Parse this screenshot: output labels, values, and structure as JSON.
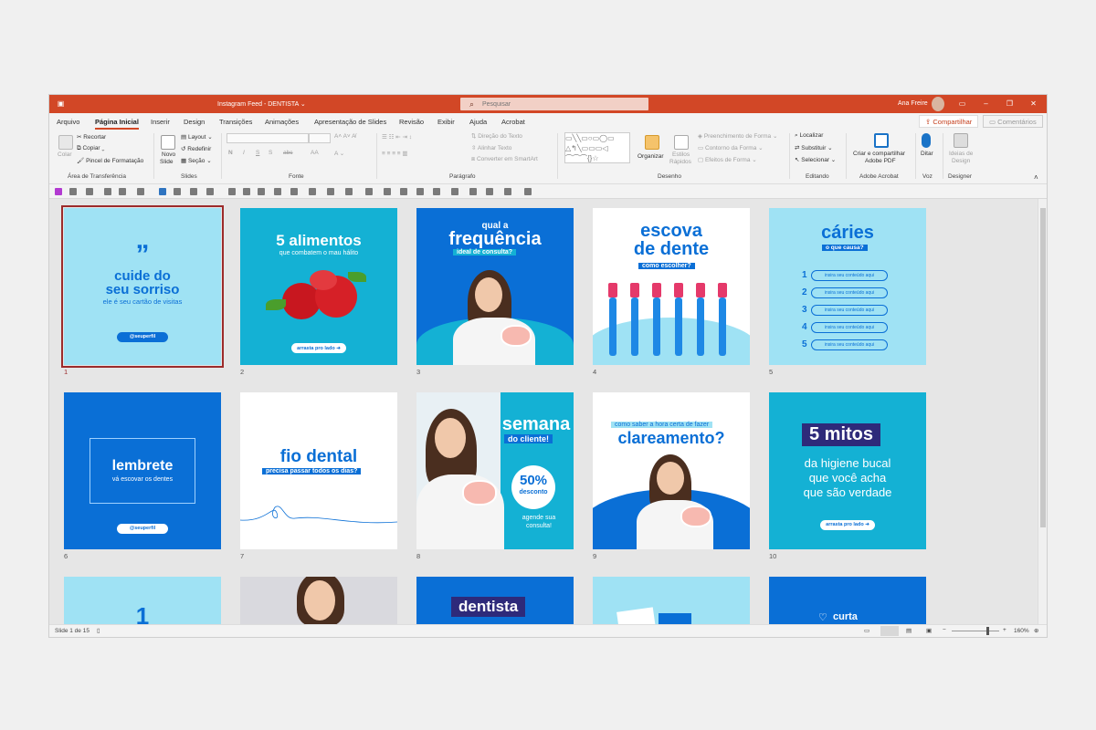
{
  "window": {
    "title": "Instagram Feed - DENTISTA",
    "title_caret": "⌄",
    "user": "Ana Freire"
  },
  "search": {
    "placeholder": "Pesquisar"
  },
  "tabs": [
    "Arquivo",
    "Página Inicial",
    "Inserir",
    "Design",
    "Transições",
    "Animações",
    "Apresentação de Slides",
    "Revisão",
    "Exibir",
    "Ajuda",
    "Acrobat"
  ],
  "share": {
    "label": "Compartilhar",
    "comments": "Comentários"
  },
  "ribbon": {
    "groups": [
      "Área de Transferência",
      "Slides",
      "Fonte",
      "Parágrafo",
      "Desenho",
      "Editando",
      "Adobe Acrobat",
      "Voz",
      "Designer"
    ],
    "clipboard": {
      "paste": "Colar",
      "cut": "Recortar",
      "copy": "Copiar",
      "format_painter": "Pincel de Formatação"
    },
    "slides": {
      "new_slide": "Novo",
      "new_slide2": "Slide",
      "layout": "Layout",
      "reset": "Redefinir",
      "section": "Seção"
    },
    "font": {
      "bold": "N",
      "italic": "I",
      "underline": "S",
      "strike": "S",
      "aa": "AA"
    },
    "paragraph": {
      "text_direction": "Direção do Texto",
      "align_text": "Alinhar Texto",
      "smartart": "Converter em SmartArt"
    },
    "drawing": {
      "arrange": "Organizar",
      "quick_styles": "Estilos",
      "quick_styles2": "Rápidos",
      "fill": "Preenchimento de Forma",
      "outline": "Contorno da Forma",
      "effects": "Efeitos de Forma"
    },
    "editing": {
      "find": "Localizar",
      "replace": "Substituir",
      "select": "Selecionar"
    },
    "acrobat": {
      "create": "Criar e compartilhar",
      "create2": "Adobe PDF"
    },
    "voice": {
      "dictate": "Ditar"
    },
    "designer": {
      "ideas": "Ideias de",
      "ideas2": "Design"
    }
  },
  "status": {
    "slide": "Slide 1 de 15",
    "zoom": "160%"
  },
  "slides": {
    "s1": {
      "num": "1",
      "quote": "„",
      "title1": "cuide do",
      "title2": "seu sorriso",
      "sub": "ele é seu cartão de visitas",
      "handle": "@seuperfil"
    },
    "s2": {
      "num": "2",
      "title": "5 alimentos",
      "sub": "que combatem o mau hálito",
      "cta": "arrasta pro lado"
    },
    "s3": {
      "num": "3",
      "pre": "qual a",
      "title": "frequência",
      "tag": "ideal de consulta?"
    },
    "s4": {
      "num": "4",
      "title1": "escova",
      "title2": "de dente",
      "tag": "como escolher?"
    },
    "s5": {
      "num": "5",
      "title": "cáries",
      "tag": "o que causa?",
      "items": [
        "1",
        "2",
        "3",
        "4",
        "5"
      ],
      "placeholder": "insira seu conteúdo aqui"
    },
    "s6": {
      "num": "6",
      "title": "lembrete",
      "sub": "vá escovar os dentes",
      "handle": "@seuperfil"
    },
    "s7": {
      "num": "7",
      "title": "fio dental",
      "tag": "precisa passar todos os dias?"
    },
    "s8": {
      "num": "8",
      "title": "semana",
      "tag": "do cliente!",
      "pct": "50%",
      "desc": "desconto",
      "cta1": "agende sua",
      "cta2": "consulta!"
    },
    "s9": {
      "num": "9",
      "tag": "como saber a hora certa de fazer",
      "title": "clareamento?"
    },
    "s10": {
      "num": "10",
      "title": "5 mitos",
      "l1": "da higiene bucal",
      "l2": "que você acha",
      "l3": "que são verdade",
      "cta": "arrasta pro lado"
    },
    "s11": {
      "big": "1"
    },
    "s13": {
      "title": "dentista"
    },
    "s15": {
      "heart": "♡",
      "title": "curta"
    }
  },
  "colors": {
    "accent": "#d24726",
    "brand_blue": "#0a6fd6",
    "light_blue": "#9fe2f4",
    "teal": "#14b1d4",
    "navy": "#2e2a7a"
  }
}
